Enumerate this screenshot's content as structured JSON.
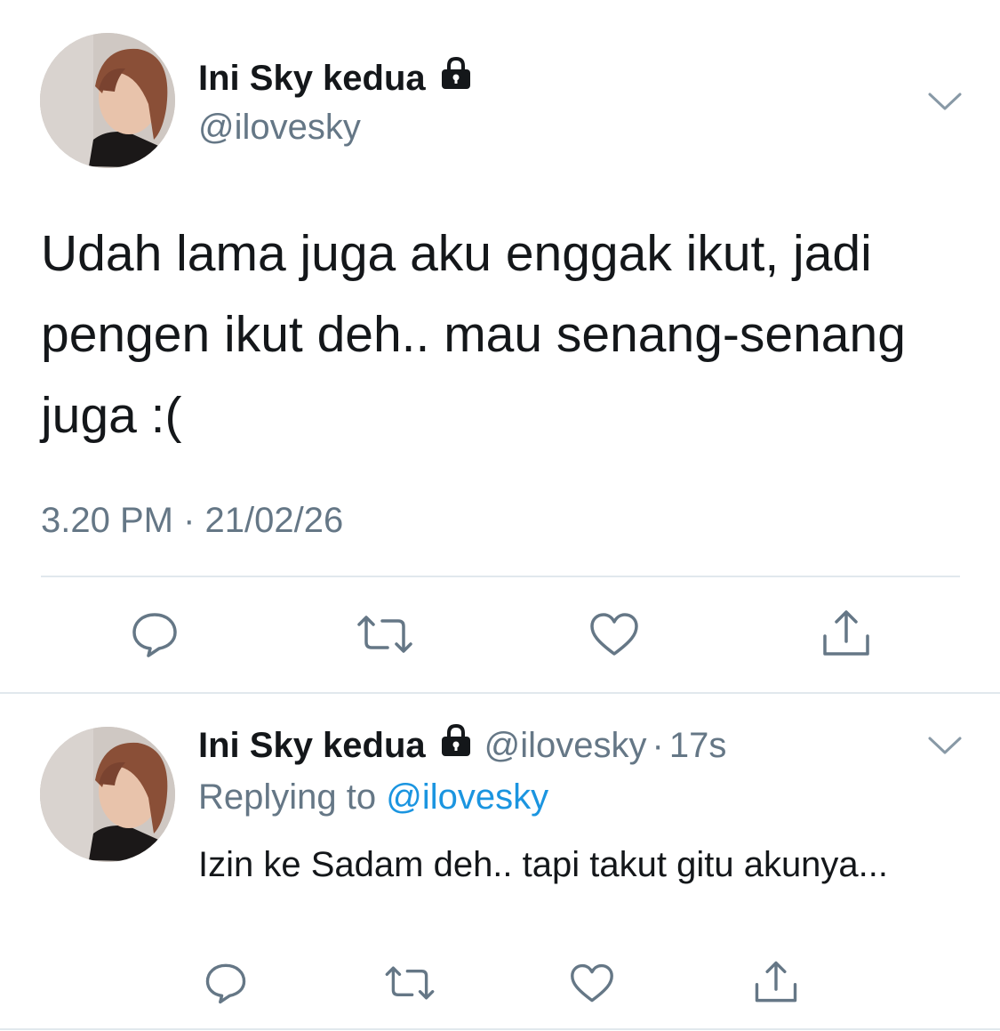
{
  "main_tweet": {
    "display_name": "Ini Sky kedua",
    "handle": "@ilovesky",
    "text": "Udah lama juga aku enggak ikut, jadi pengen ikut deh.. mau senang-senang juga :(",
    "timestamp": "3.20 PM · 21/02/26",
    "avatar_icon": "profile-photo",
    "protected_icon": "lock-icon"
  },
  "reply_tweet": {
    "display_name": "Ini Sky kedua",
    "handle": "@ilovesky",
    "separator": "·",
    "relative_time": "17s",
    "replying_prefix": "Replying to ",
    "replying_to": "@ilovesky",
    "text": "Izin ke Sadam deh.. tapi takut gitu akunya...",
    "avatar_icon": "profile-photo",
    "protected_icon": "lock-icon"
  },
  "actions": [
    "reply-icon",
    "retweet-icon",
    "like-icon",
    "share-icon"
  ],
  "colors": {
    "text": "#14171a",
    "secondary": "#657786",
    "link": "#1b95e0",
    "divider": "#e1e8ed"
  }
}
